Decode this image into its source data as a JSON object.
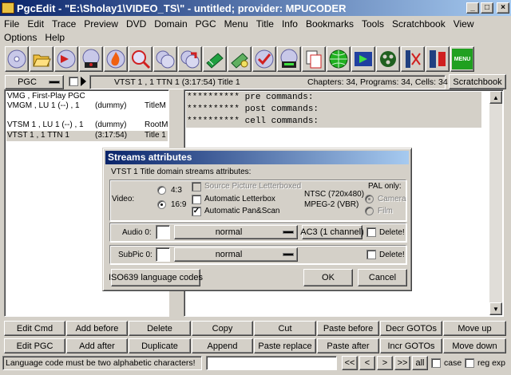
{
  "window": {
    "title": "PgcEdit -  \"E:\\Sholay1\\VIDEO_TS\\\" - untitled; provider: MPUCODER",
    "minimize": "_",
    "maximize": "□",
    "close": "×"
  },
  "menu": {
    "row1": [
      "File",
      "Edit",
      "Trace",
      "Preview",
      "DVD",
      "Domain",
      "PGC",
      "Menu",
      "Title",
      "Info",
      "Bookmarks",
      "Tools",
      "Scratchbook",
      "View"
    ],
    "row2": [
      "Options",
      "Help"
    ]
  },
  "toolbar": {
    "icons": [
      "disc-icon",
      "open-folder-icon",
      "play-disc-icon",
      "disc-rec-icon",
      "flame-icon",
      "search-disc-icon",
      "two-discs-icon",
      "discs-arrow-icon",
      "book-edit-icon",
      "book-preview-icon",
      "check-disc-icon",
      "disc-time-icon",
      "copy-doc-icon",
      "globe-icon",
      "film-play-icon",
      "reel-icon",
      "film-cut-icon",
      "film-red-icon",
      "menu-icon"
    ],
    "menu_icon_label": "MENU"
  },
  "pgcbar": {
    "combo": "PGC",
    "info": "VTST 1 , 1     TTN 1  (3:17:54)  Title 1",
    "stats": "Chapters: 34,  Programs: 34,  Cells: 34",
    "scratchbook": "Scratchbook"
  },
  "tree": {
    "rows": [
      {
        "c1": "VMG , First-Play PGC",
        "c2": "",
        "c3": ""
      },
      {
        "c1": "VMGM , LU 1 (--) , 1",
        "c2": "(dummy)",
        "c3": "TitleM"
      },
      {
        "c1": "",
        "c2": "",
        "c3": ""
      },
      {
        "c1": "VTSM 1 , LU 1 (--) , 1",
        "c2": "(dummy)",
        "c3": "RootM"
      },
      {
        "c1": "VTST 1 , 1        TTN 1",
        "c2": "(3:17:54)",
        "c3": "Title 1"
      }
    ]
  },
  "commands": {
    "pre": "********** pre commands:",
    "post": "********** post commands:",
    "cell": "********** cell commands:"
  },
  "dialog": {
    "title": "Streams attributes",
    "subtitle": "VTST 1 Title domain streams attributes:",
    "video_label": "Video:",
    "aspect_43": "4:3",
    "aspect_169": "16:9",
    "opt_source_lb": "Source Picture Letterboxed",
    "opt_auto_lb": "Automatic Letterbox",
    "opt_auto_ps": "Automatic Pan&Scan",
    "video_std": "NTSC (720x480)",
    "video_codec": "MPEG-2 (VBR)",
    "pal_only": "PAL only:",
    "pal_camera": "Camera",
    "pal_film": "Film",
    "audio_label": "Audio 0:",
    "audio_mode": "normal",
    "audio_format": "AC3 (1 channel)",
    "delete_label": "Delete!",
    "subpic_label": "SubPic 0:",
    "subpic_mode": "normal",
    "iso_button": "ISO639 language codes",
    "ok": "OK",
    "cancel": "Cancel"
  },
  "buttons": {
    "row1": [
      "Edit Cmd",
      "Add before",
      "Delete",
      "Copy",
      "Cut",
      "Paste before",
      "Decr GOTOs",
      "Move up"
    ],
    "row2": [
      "Edit PGC",
      "Add after",
      "Duplicate",
      "Append",
      "Paste replace",
      "Paste after",
      "Incr GOTOs",
      "Move down"
    ]
  },
  "status": {
    "message": "Language code must be two alphabetic characters!",
    "nav": [
      "<<",
      "<",
      ">",
      ">>"
    ],
    "all": "all",
    "case": "case",
    "regexp": "reg exp"
  }
}
